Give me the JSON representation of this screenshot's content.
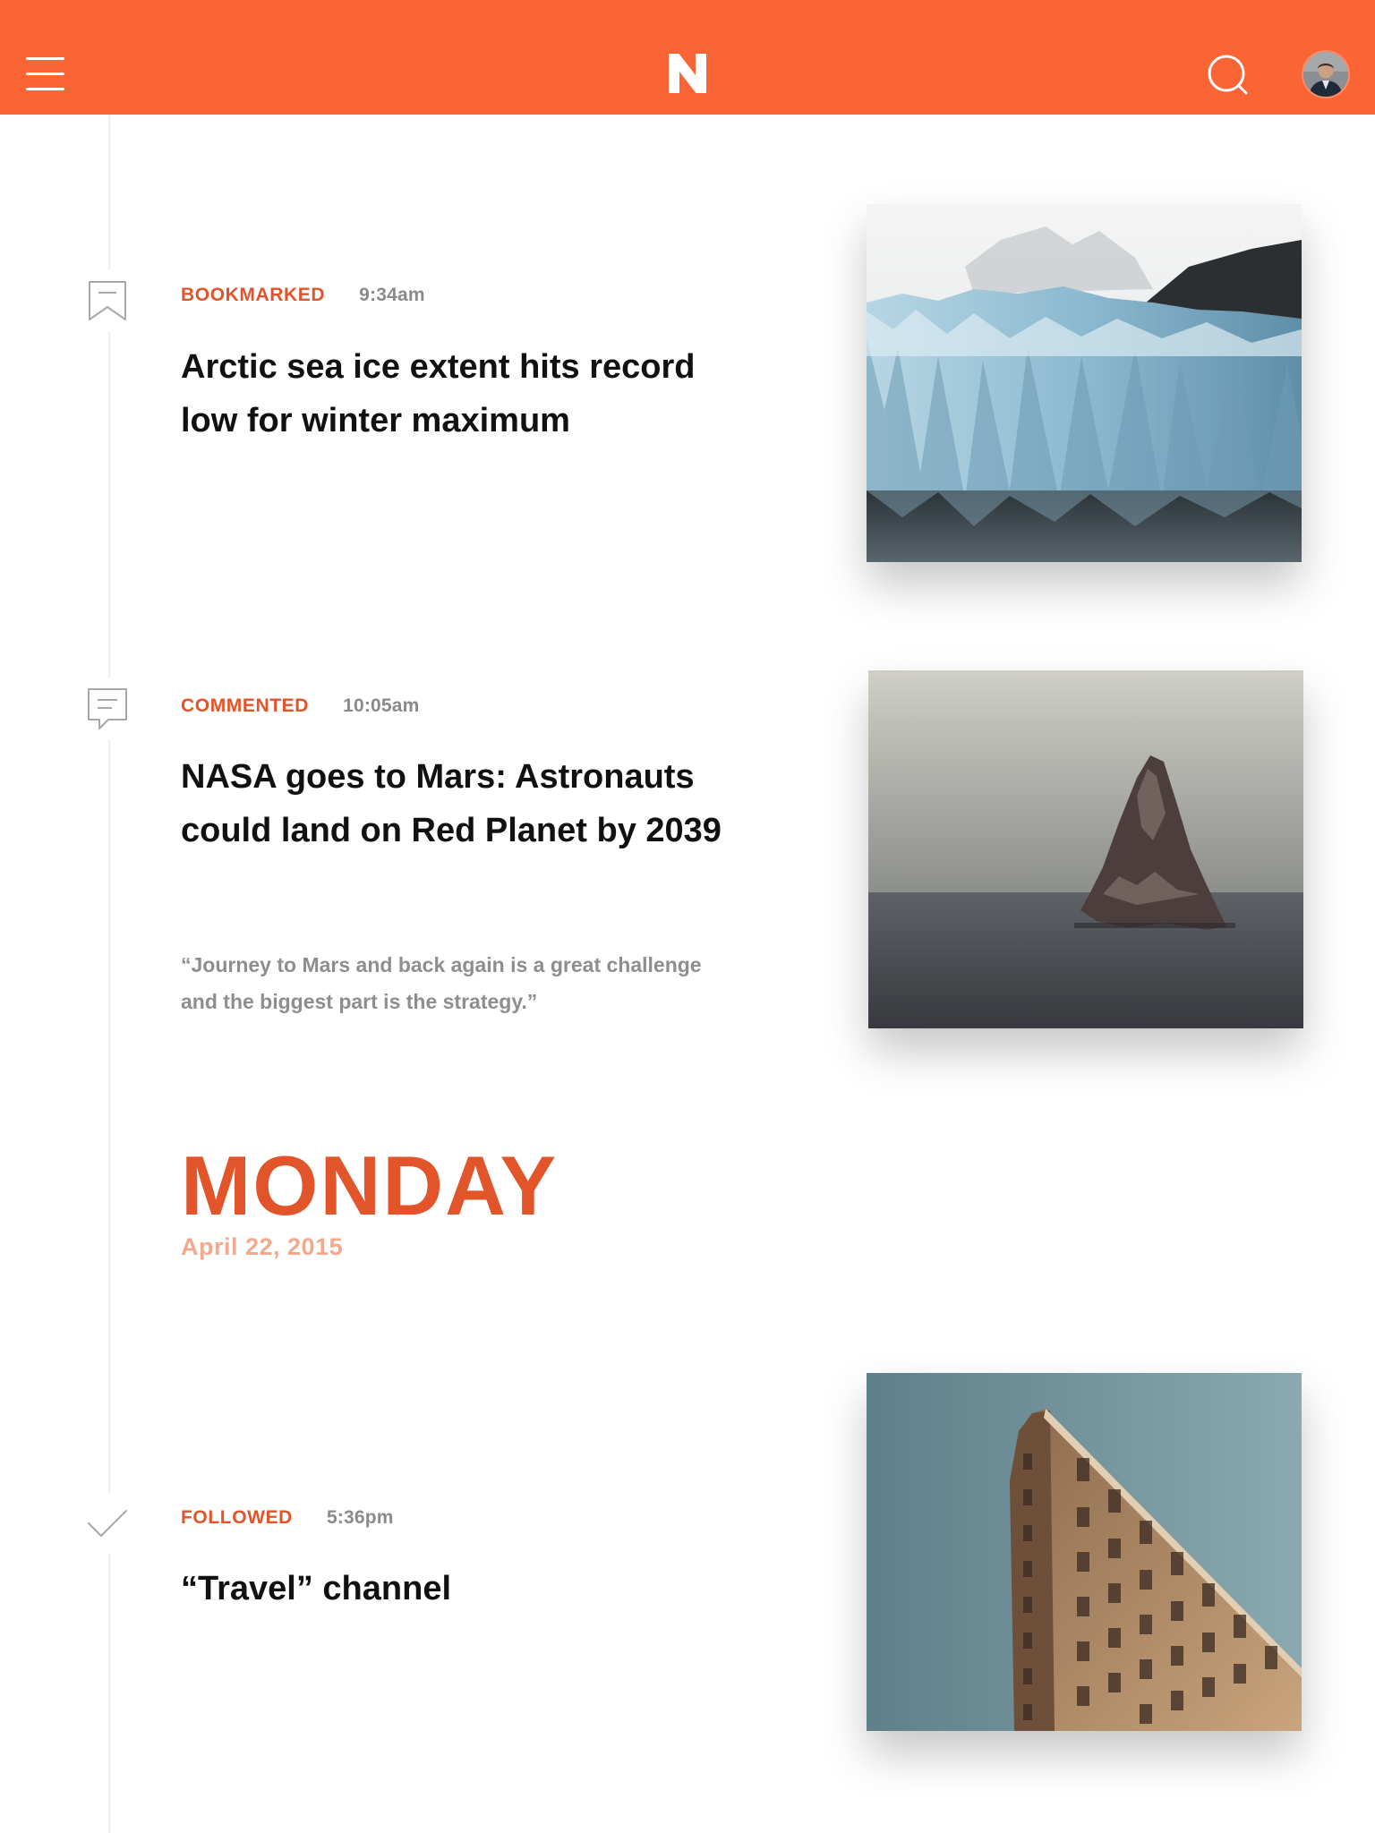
{
  "header": {
    "logo_letter": "N",
    "menu_icon": "hamburger-menu-icon",
    "search_icon": "search-icon",
    "avatar_icon": "user-avatar",
    "background_color": "#fb6536"
  },
  "colors": {
    "accent": "#e2542a",
    "date_light": "#f2a98e",
    "headline": "#111111",
    "muted": "#8a8a8a"
  },
  "feed": [
    {
      "icon": "bookmark-icon",
      "action": "BOOKMARKED",
      "time": "9:34am",
      "headline": "Arctic sea ice extent hits record low for winter maximum",
      "image": "glacier-photo"
    },
    {
      "icon": "comment-icon",
      "action": "COMMENTED",
      "time": "10:05am",
      "headline": "NASA goes to Mars: Astronauts could land on Red Planet by 2039",
      "quote": "“Journey to Mars and back again is a great challenge and the biggest part is the strategy.”",
      "image": "sea-rock-photo"
    },
    {
      "icon": "checkmark-icon",
      "action": "FOLLOWED",
      "time": "5:36pm",
      "headline": "“Travel” channel",
      "image": "building-photo"
    }
  ],
  "day_divider": {
    "day": "MONDAY",
    "date": "April 22, 2015"
  }
}
